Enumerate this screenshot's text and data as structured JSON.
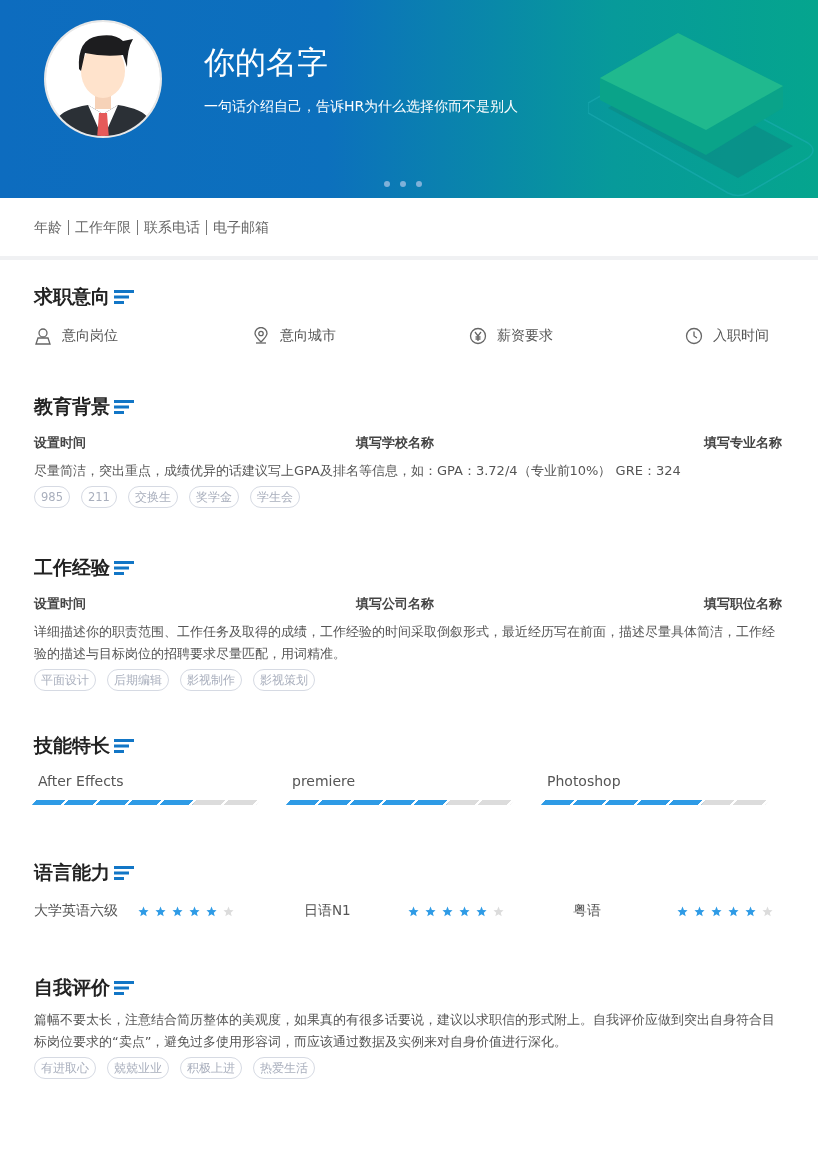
{
  "header": {
    "name": "你的名字",
    "tagline": "一句话介绍自己，告诉HR为什么选择你而不是别人"
  },
  "info": [
    "年龄",
    "工作年限",
    "联系电话",
    "电子邮箱"
  ],
  "intent": {
    "title": "求职意向",
    "items": [
      {
        "kind": "person",
        "label": "意向岗位"
      },
      {
        "kind": "location",
        "label": "意向城市"
      },
      {
        "kind": "salary",
        "label": "薪资要求"
      },
      {
        "kind": "time",
        "label": "入职时间"
      }
    ]
  },
  "education": {
    "title": "教育背景",
    "columns": [
      "设置时间",
      "填写学校名称",
      "填写专业名称"
    ],
    "description": "尽量简洁，突出重点，成绩优异的话建议写上GPA及排名等信息，如：GPA：3.72/4（专业前10%） GRE：324",
    "tags": [
      "985",
      "211",
      "交换生",
      "奖学金",
      "学生会"
    ]
  },
  "work": {
    "title": "工作经验",
    "columns": [
      "设置时间",
      "填写公司名称",
      "填写职位名称"
    ],
    "description": "详细描述你的职责范围、工作任务及取得的成绩，工作经验的时间采取倒叙形式，最近经历写在前面，描述尽量具体简洁，工作经验的描述与目标岗位的招聘要求尽量匹配，用词精准。",
    "tags": [
      "平面设计",
      "后期编辑",
      "影视制作",
      "影视策划"
    ]
  },
  "skills": {
    "title": "技能特长",
    "items": [
      {
        "name": "After Effects",
        "level": 0.714
      },
      {
        "name": "premiere",
        "level": 0.714
      },
      {
        "name": "Photoshop",
        "level": 0.714
      }
    ]
  },
  "languages": {
    "title": "语言能力",
    "items": [
      {
        "name": "大学英语六级",
        "stars": 5
      },
      {
        "name": "日语N1",
        "stars": 5
      },
      {
        "name": "粤语",
        "stars": 5
      }
    ]
  },
  "self": {
    "title": "自我评价",
    "description": "篇幅不要太长，注意结合简历整体的美观度，如果真的有很多话要说，建议以求职信的形式附上。自我评价应做到突出自身符合目标岗位要求的“卖点”，避免过多使用形容词，而应该通过数据及实例来对自身价值进行深化。",
    "tags": [
      "有进取心",
      "兢兢业业",
      "积极上进",
      "热爱生活"
    ]
  }
}
